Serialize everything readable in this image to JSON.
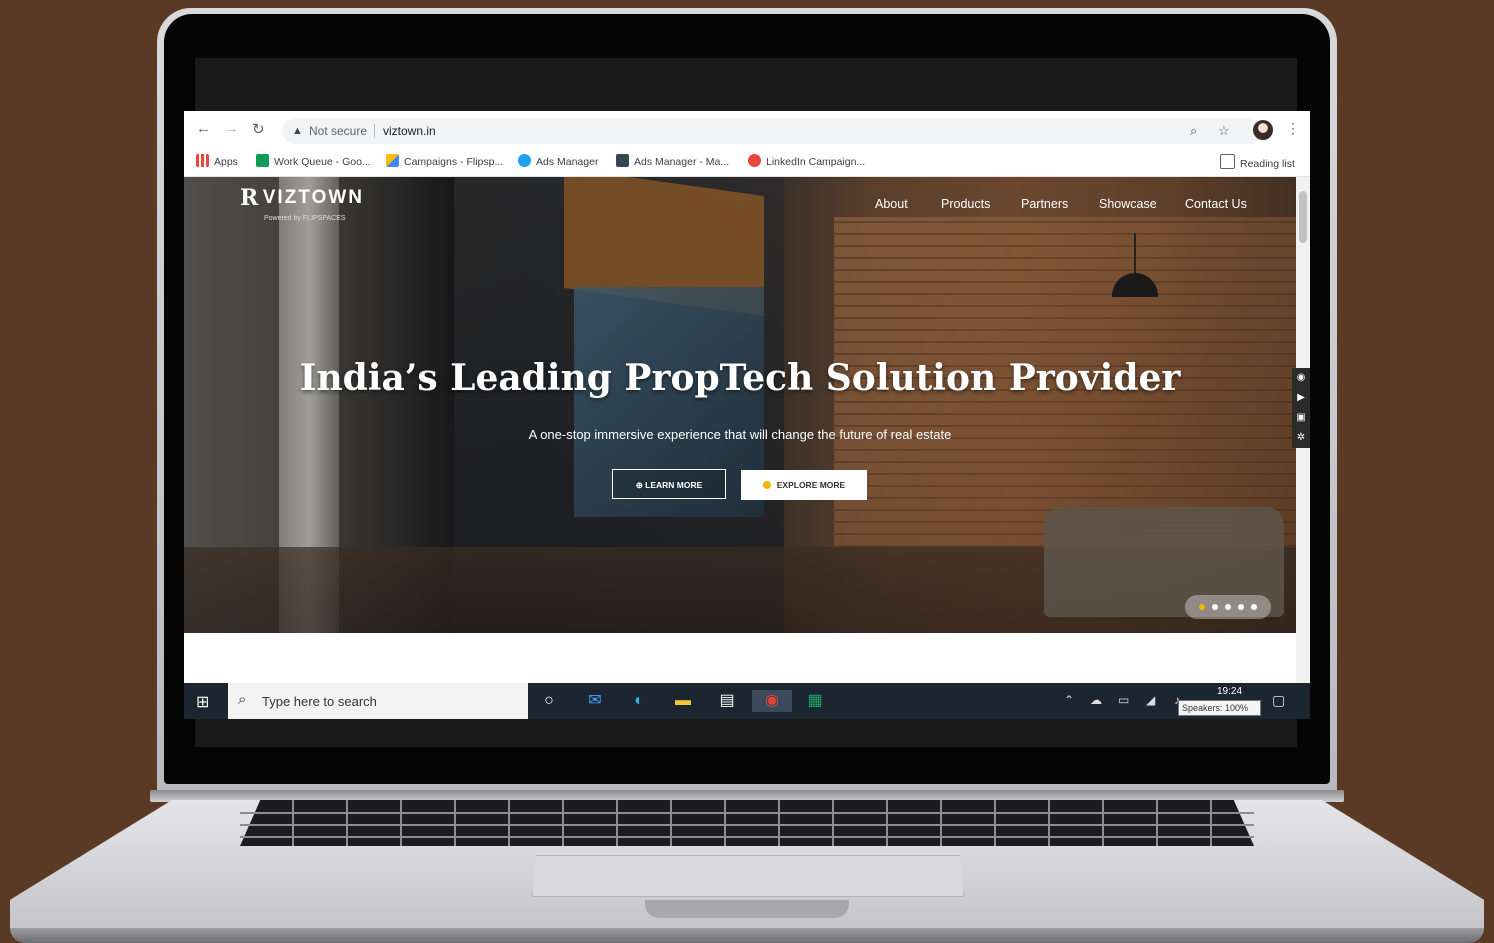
{
  "browser": {
    "security_label": "Not secure",
    "url": "viztown.in",
    "bookmarks": [
      {
        "label": "Apps",
        "color": "#e8453c"
      },
      {
        "label": "Work Queue - Goo...",
        "color": "#0f9d58"
      },
      {
        "label": "Campaigns - Flipsp...",
        "color": "#4285f4"
      },
      {
        "label": "Ads Manager",
        "color": "#1da1f2"
      },
      {
        "label": "Ads Manager - Ma...",
        "color": "#37474f"
      },
      {
        "label": "LinkedIn Campaign...",
        "color": "#e8453c"
      }
    ],
    "reading_list": "Reading list"
  },
  "site": {
    "logo_text": "VIZTOWN",
    "logo_sub": "Powered by FLIPSPACES",
    "nav": [
      "About",
      "Products",
      "Partners",
      "Showcase",
      "Contact Us"
    ],
    "headline": "India’s Leading PropTech Solution Provider",
    "tagline": "A one-stop immersive experience that will change the future of real estate",
    "learn_more": "LEARN MORE",
    "explore_more": "EXPLORE MORE",
    "carousel_slides": 5,
    "carousel_active": 1,
    "accent": "#f2b705"
  },
  "taskbar": {
    "search_placeholder": "Type here to search",
    "time": "19:24",
    "tooltip": "Speakers: 100%"
  }
}
